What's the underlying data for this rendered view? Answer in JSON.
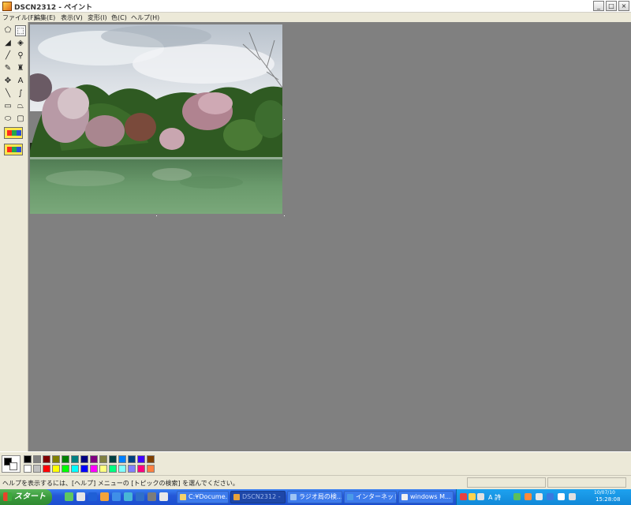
{
  "window": {
    "title": "DSCN2312 - ペイント",
    "controls": {
      "minimize": "_",
      "maximize": "□",
      "close": "×"
    }
  },
  "menu": [
    {
      "label": "ファイル(F)"
    },
    {
      "label": "編集(E)"
    },
    {
      "label": "表示(V)"
    },
    {
      "label": "変形(I)"
    },
    {
      "label": "色(C)"
    },
    {
      "label": "ヘルプ(H)"
    }
  ],
  "toolbox": {
    "tools": [
      {
        "name": "free-form-select-icon",
        "glyph": "⬠"
      },
      {
        "name": "rect-select-icon",
        "glyph": "⬚",
        "selected": true
      },
      {
        "name": "eraser-icon",
        "glyph": "◢"
      },
      {
        "name": "fill-icon",
        "glyph": "◈"
      },
      {
        "name": "color-picker-icon",
        "glyph": "╱"
      },
      {
        "name": "magnifier-icon",
        "glyph": "⚲"
      },
      {
        "name": "pencil-icon",
        "glyph": "✎"
      },
      {
        "name": "brush-icon",
        "glyph": "♜"
      },
      {
        "name": "airbrush-icon",
        "glyph": "✥"
      },
      {
        "name": "text-icon",
        "glyph": "A"
      },
      {
        "name": "line-icon",
        "glyph": "╲"
      },
      {
        "name": "curve-icon",
        "glyph": "∫"
      },
      {
        "name": "rectangle-icon",
        "glyph": "▭"
      },
      {
        "name": "polygon-icon",
        "glyph": "⏢"
      },
      {
        "name": "ellipse-icon",
        "glyph": "⬭"
      },
      {
        "name": "rounded-rect-icon",
        "glyph": "▢"
      }
    ],
    "option_colors": [
      "#ff2a1c",
      "#22a64a",
      "#2b4fd8"
    ]
  },
  "colors": {
    "foreground": "#000000",
    "background": "#ffffff",
    "palette_top": [
      "#000000",
      "#808080",
      "#800000",
      "#808000",
      "#008000",
      "#008080",
      "#000080",
      "#800080",
      "#808040",
      "#004040",
      "#0080ff",
      "#004080",
      "#4000ff",
      "#804000"
    ],
    "palette_bottom": [
      "#ffffff",
      "#c0c0c0",
      "#ff0000",
      "#ffff00",
      "#00ff00",
      "#00ffff",
      "#0000ff",
      "#ff00ff",
      "#ffff80",
      "#00ff80",
      "#80ffff",
      "#8080ff",
      "#ff0080",
      "#ff8040"
    ]
  },
  "status": {
    "help_text": "ヘルプを表示するには、[ヘルプ] メニューの [トピックの検索] を選んでください。"
  },
  "taskbar": {
    "start_label": "スタート",
    "quick_launch_colors": [
      "#5fc85f",
      "#e6e6e6",
      "#1f5fd6",
      "#f2a43a",
      "#3f8fe8",
      "#48b6d6",
      "#2f6fc9",
      "#7c7c7c",
      "#e8e8e8"
    ],
    "tasks": [
      {
        "label": "C:¥Docume...",
        "icon_color": "#f3d26b",
        "active": false
      },
      {
        "label": "DSCN2312 -",
        "icon_color": "#e8a33b",
        "active": true
      },
      {
        "label": "ラジオ局の検...",
        "icon_color": "#9ec4f4",
        "active": false
      },
      {
        "label": "インターネット...",
        "icon_color": "#4a9ae8",
        "active": false
      },
      {
        "label": "windows M...",
        "icon_color": "#f0f0f0",
        "active": false
      }
    ],
    "tray": {
      "text": "A 詩",
      "icon_colors": [
        "#e84040",
        "#ffd34d",
        "#e0e0e0",
        "#5bbf5b",
        "#ff8a3a",
        "#e8e8e8",
        "#3a7ae0",
        "#ffffff",
        "#e0e0e0"
      ],
      "date": "10/07/10",
      "time": "15:28:08"
    }
  }
}
